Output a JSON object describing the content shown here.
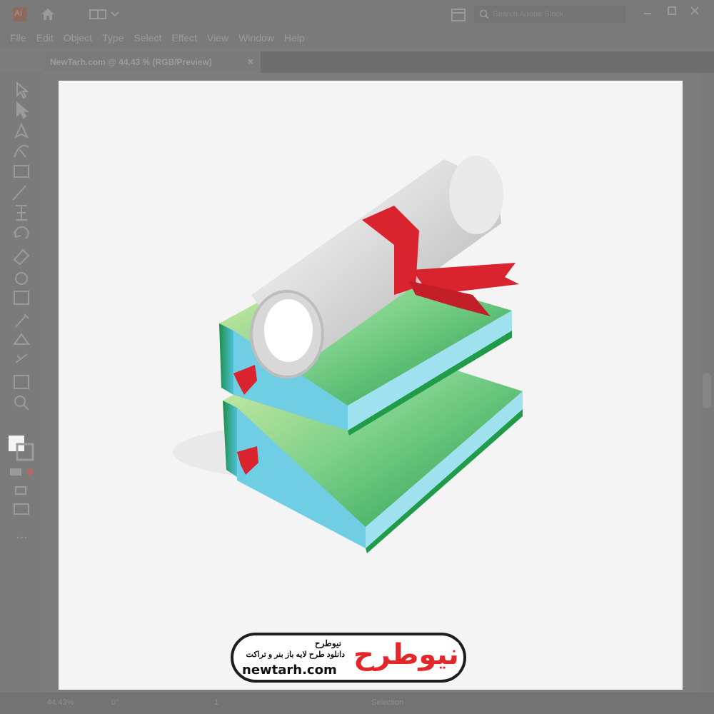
{
  "app": {
    "logo": "Ai",
    "search_placeholder": "Search Adobe Stock"
  },
  "menu": [
    "File",
    "Edit",
    "Object",
    "Type",
    "Select",
    "Effect",
    "View",
    "Window",
    "Help"
  ],
  "document_tab": {
    "title": "NewTarh.com @ 44.43 % (RGB/Preview)",
    "close": "×"
  },
  "status": {
    "zoom": "44.43%",
    "rotation": "0°",
    "artboard": "1",
    "tool": "Selection"
  },
  "watermark": {
    "name_fa": "نیوطرح",
    "tagline_fa": "دانلود طرح لایه باز بنر و تراکت",
    "url": "newtarh.com",
    "brand_fa": "نیوطرح"
  },
  "colors": {
    "ui_gray": "#7b7b7b",
    "artboard": "#f4f4f4",
    "book_green": "#2ea85a",
    "book_pages": "#8fd8ec",
    "ribbon_red": "#d9232e",
    "brand_red": "#e3262a",
    "brand_blue": "#1b4fa3"
  },
  "tools": [
    "selection-tool-icon",
    "direct-selection-tool-icon",
    "pen-tool-icon",
    "curvature-tool-icon",
    "rectangle-tool-icon",
    "paintbrush-tool-icon",
    "width-tool-icon",
    "rotate-tool-icon",
    "eraser-tool-icon",
    "shape-builder-tool-icon",
    "gradient-tool-icon",
    "eyedropper-tool-icon",
    "blend-tool-icon",
    "symbol-sprayer-tool-icon",
    "artboard-tool-icon",
    "zoom-tool-icon"
  ]
}
